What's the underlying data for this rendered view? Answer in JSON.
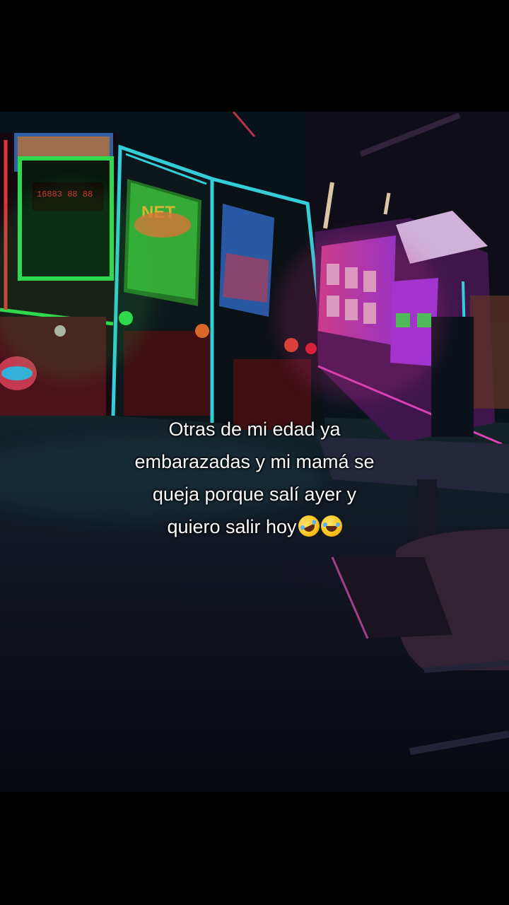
{
  "caption": {
    "lines": [
      "Otras de mi edad ya",
      "embarazadas y mi mamá se",
      "queja porque salí ayer y",
      "quiero salir hoy"
    ],
    "emojis": [
      "rofl-emoji",
      "joy-emoji"
    ]
  },
  "scene": {
    "arcade_screen_text": [
      "NET"
    ],
    "colors": {
      "neon_green": "#39ff5a",
      "neon_cyan": "#3ef3ff",
      "neon_pink": "#ff3fb0",
      "neon_magenta": "#d43cff",
      "cabinet_red": "#7a1420",
      "floor": "#0c0d18"
    }
  }
}
